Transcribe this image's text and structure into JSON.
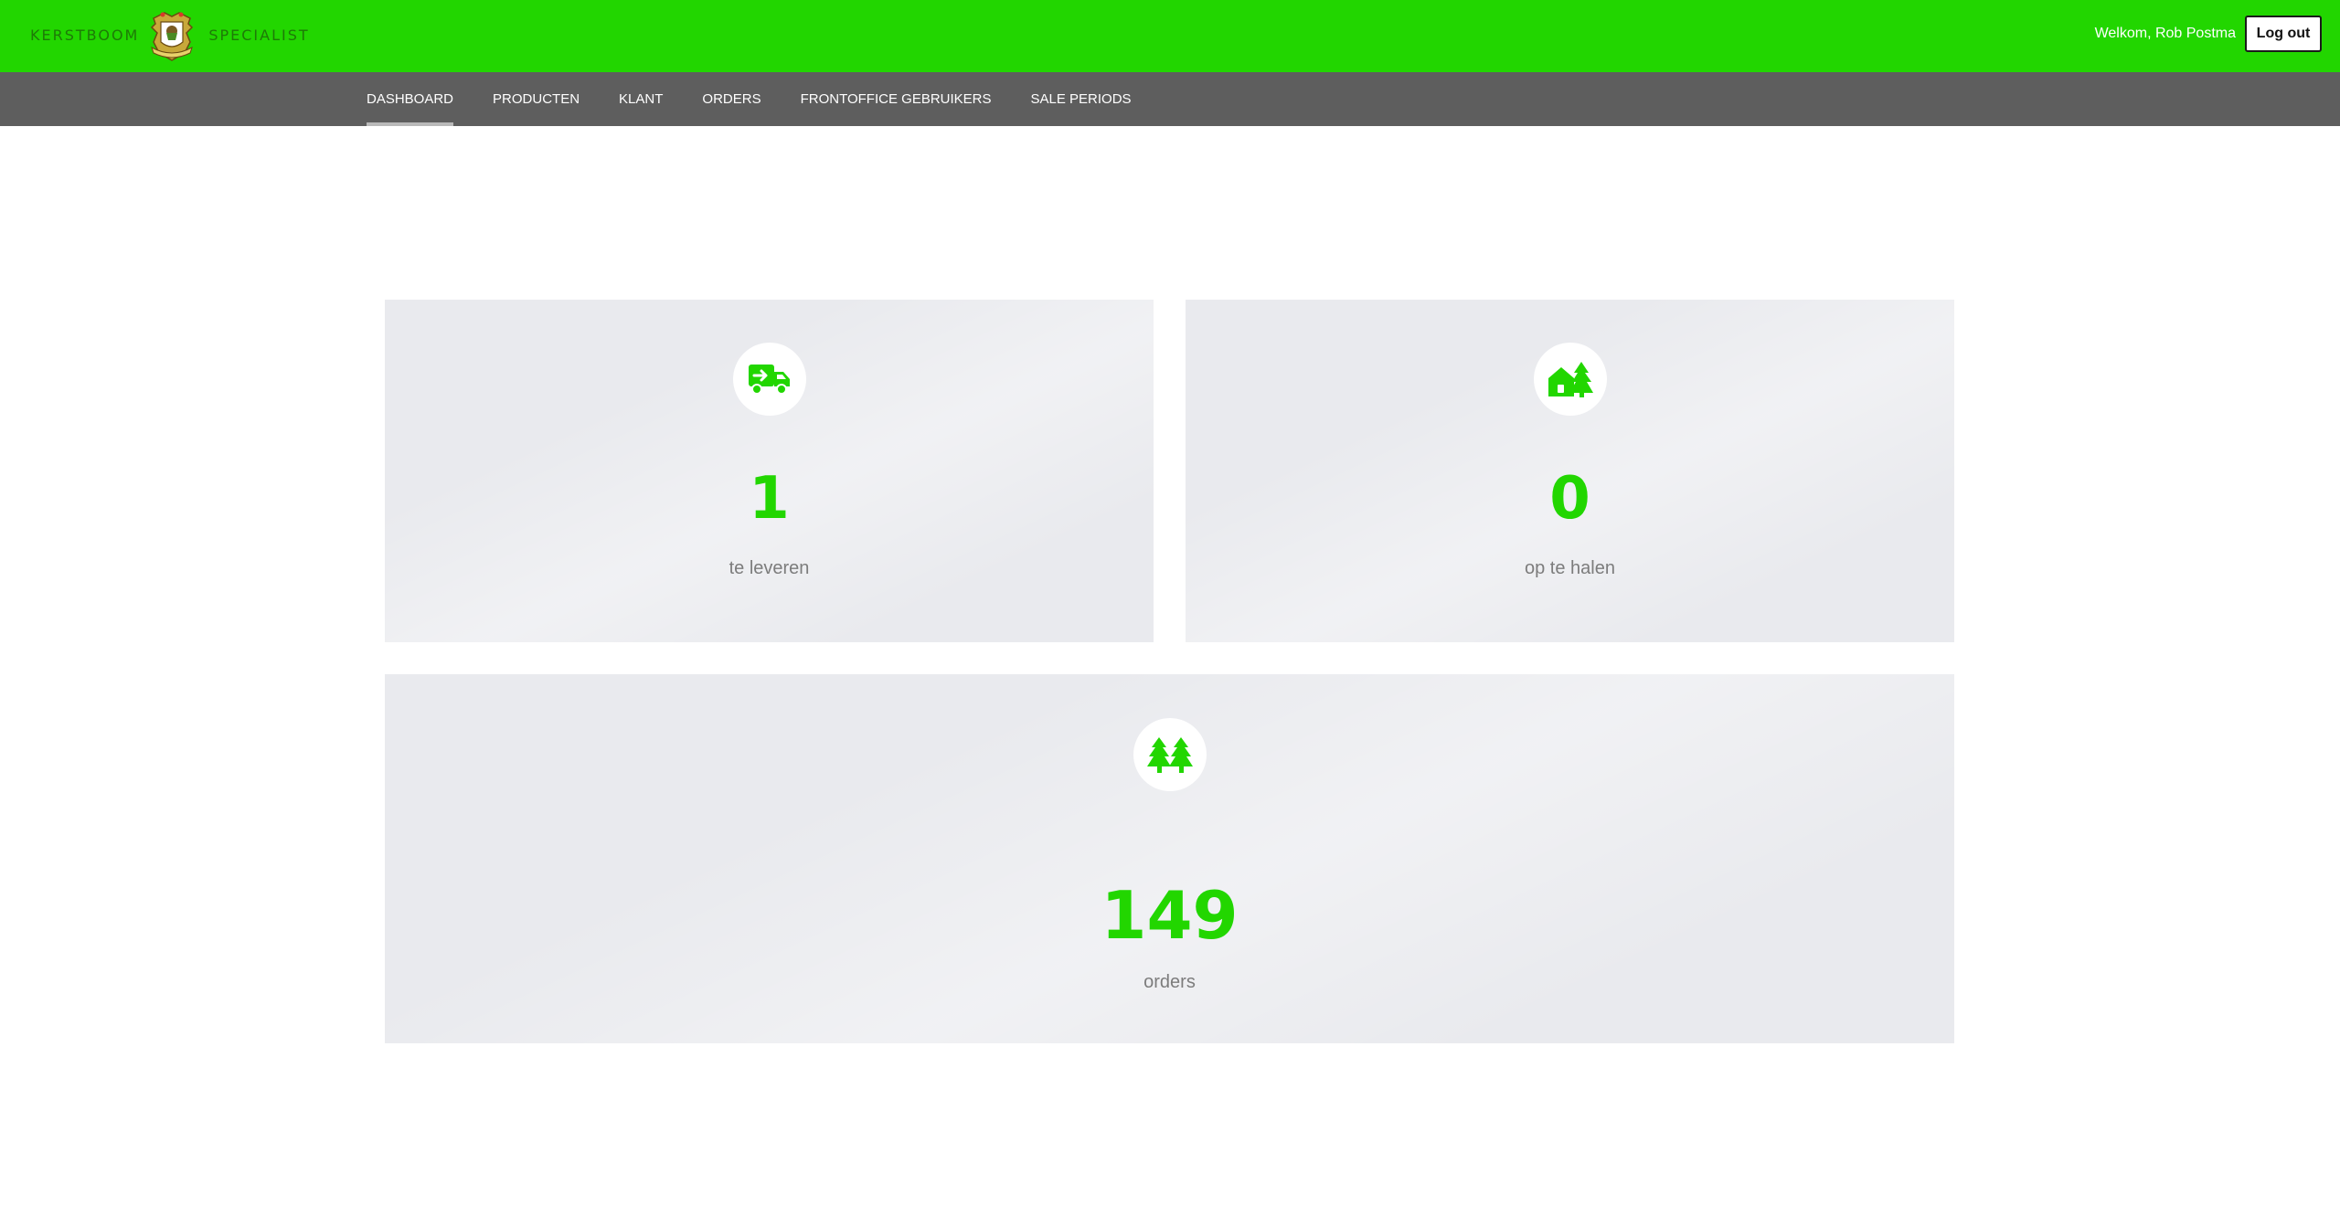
{
  "header": {
    "brand_left": "KERSTBOOM",
    "brand_right": "SPECIALIST",
    "welcome": "Welkom, Rob Postma",
    "logout_label": "Log out"
  },
  "nav": {
    "items": [
      {
        "label": "DASHBOARD",
        "active": true
      },
      {
        "label": "PRODUCTEN"
      },
      {
        "label": "KLANT"
      },
      {
        "label": "ORDERS"
      },
      {
        "label": "FRONTOFFICE GEBRUIKERS"
      },
      {
        "label": "SALE PERIODS"
      }
    ]
  },
  "stats": {
    "deliver": {
      "value": "1",
      "label": "te leveren",
      "icon": "delivery-truck-icon"
    },
    "pickup": {
      "value": "0",
      "label": "op te halen",
      "icon": "house-tree-icon"
    },
    "orders": {
      "value": "149",
      "label": "orders",
      "icon": "trees-icon"
    }
  },
  "colors": {
    "accent": "#22d600",
    "nav_bg": "#5e5e5e",
    "card_bg": "#e9eaee"
  }
}
